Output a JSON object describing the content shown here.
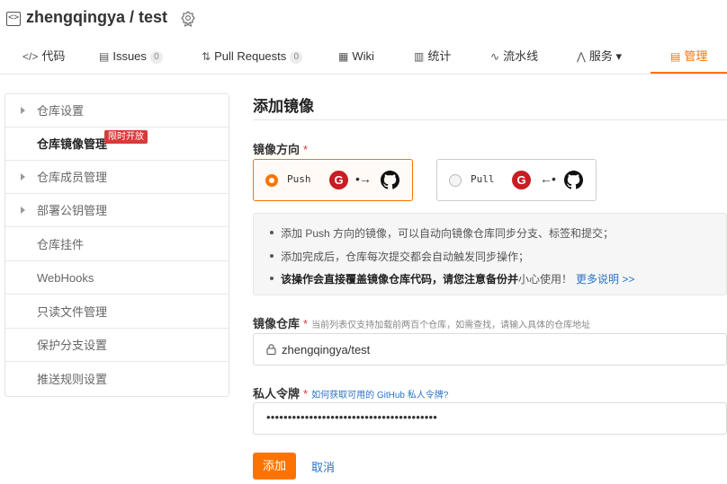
{
  "repo": {
    "title": "zhengqingya / test"
  },
  "tabs": [
    {
      "icon": "</>",
      "label": "代码"
    },
    {
      "icon": "▤",
      "label": "Issues",
      "count": "0"
    },
    {
      "icon": "⇅",
      "label": "Pull Requests",
      "count": "0"
    },
    {
      "icon": "▦",
      "label": "Wiki"
    },
    {
      "icon": "▥",
      "label": "统计"
    },
    {
      "icon": "∿",
      "label": "流水线"
    },
    {
      "icon": "⋀",
      "label": "服务 ▾"
    },
    {
      "icon": "▤",
      "label": "管理"
    }
  ],
  "sidebar": {
    "items": [
      {
        "label": "仓库设置"
      },
      {
        "label": "仓库镜像管理",
        "badge": "限时开放"
      },
      {
        "label": "仓库成员管理"
      },
      {
        "label": "部署公钥管理"
      },
      {
        "label": "仓库挂件"
      },
      {
        "label": "WebHooks"
      },
      {
        "label": "只读文件管理"
      },
      {
        "label": "保护分支设置"
      },
      {
        "label": "推送规则设置"
      }
    ]
  },
  "main": {
    "title": "添加镜像",
    "direction": {
      "label": "镜像方向",
      "required": "*",
      "options": [
        {
          "label": "Push",
          "arrow": "•→",
          "selected": true
        },
        {
          "label": "Pull",
          "arrow": "←•",
          "selected": false
        }
      ]
    },
    "info": {
      "line1": "添加 Push 方向的镜像，可以自动向镜像仓库同步分支、标签和提交；",
      "line2": "添加完成后，仓库每次提交都会自动触发同步操作；",
      "line3_bold": "该操作会直接覆盖镜像仓库代码，请您注意备份并",
      "line3_rest": "小心使用！",
      "line3_link": "更多说明 >>"
    },
    "repo_field": {
      "label": "镜像仓库",
      "required": "*",
      "hint": "当前列表仅支持加载前两百个仓库，如需查找，请输入具体的仓库地址",
      "value": "zhengqingya/test"
    },
    "token_field": {
      "label": "私人令牌",
      "required": "*",
      "hint_link": "如何获取可用的 GitHub 私人令牌?",
      "value": "••••••••••••••••••••••••••••••••••••••••"
    },
    "buttons": {
      "add": "添加",
      "cancel": "取消"
    }
  },
  "colors": {
    "accent": "#fe7300",
    "gitee": "#c71d23",
    "link": "#2a73c5",
    "badge": "#d93a3a"
  }
}
